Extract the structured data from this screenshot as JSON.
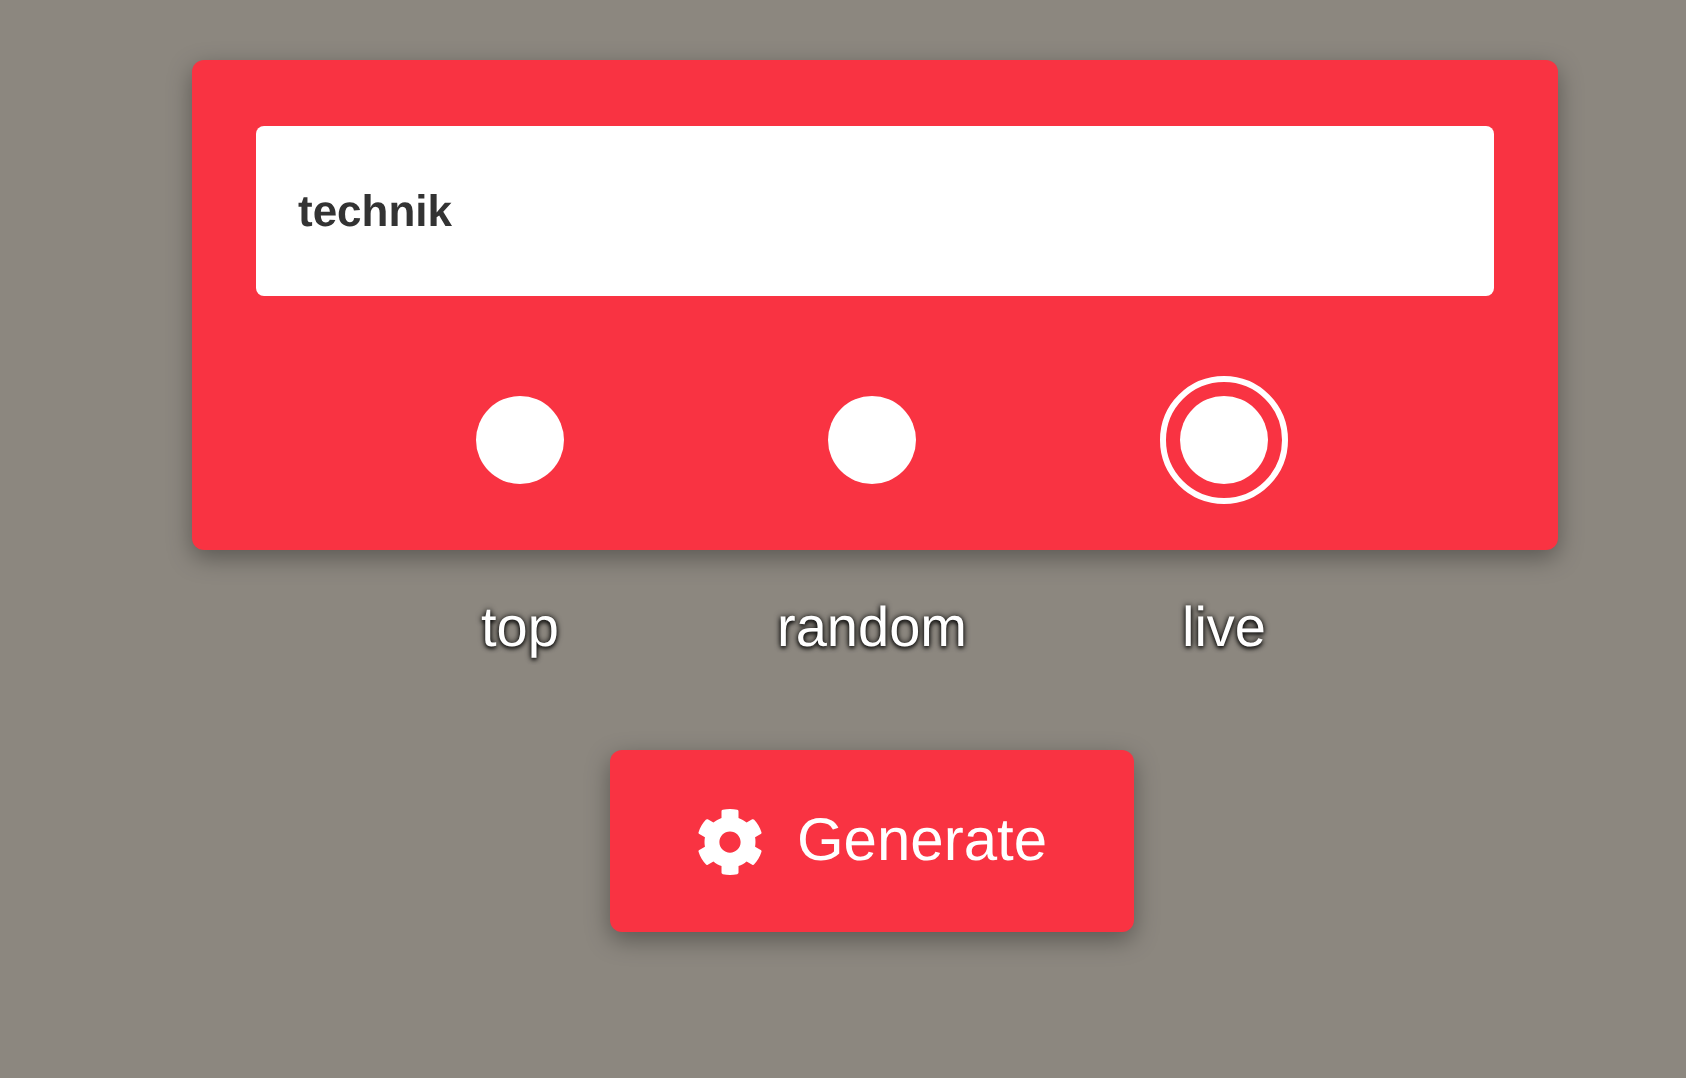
{
  "search": {
    "value": "technik"
  },
  "modes": [
    {
      "label": "top",
      "selected": false
    },
    {
      "label": "random",
      "selected": false
    },
    {
      "label": "live",
      "selected": true
    }
  ],
  "generate_button": {
    "label": "Generate"
  }
}
